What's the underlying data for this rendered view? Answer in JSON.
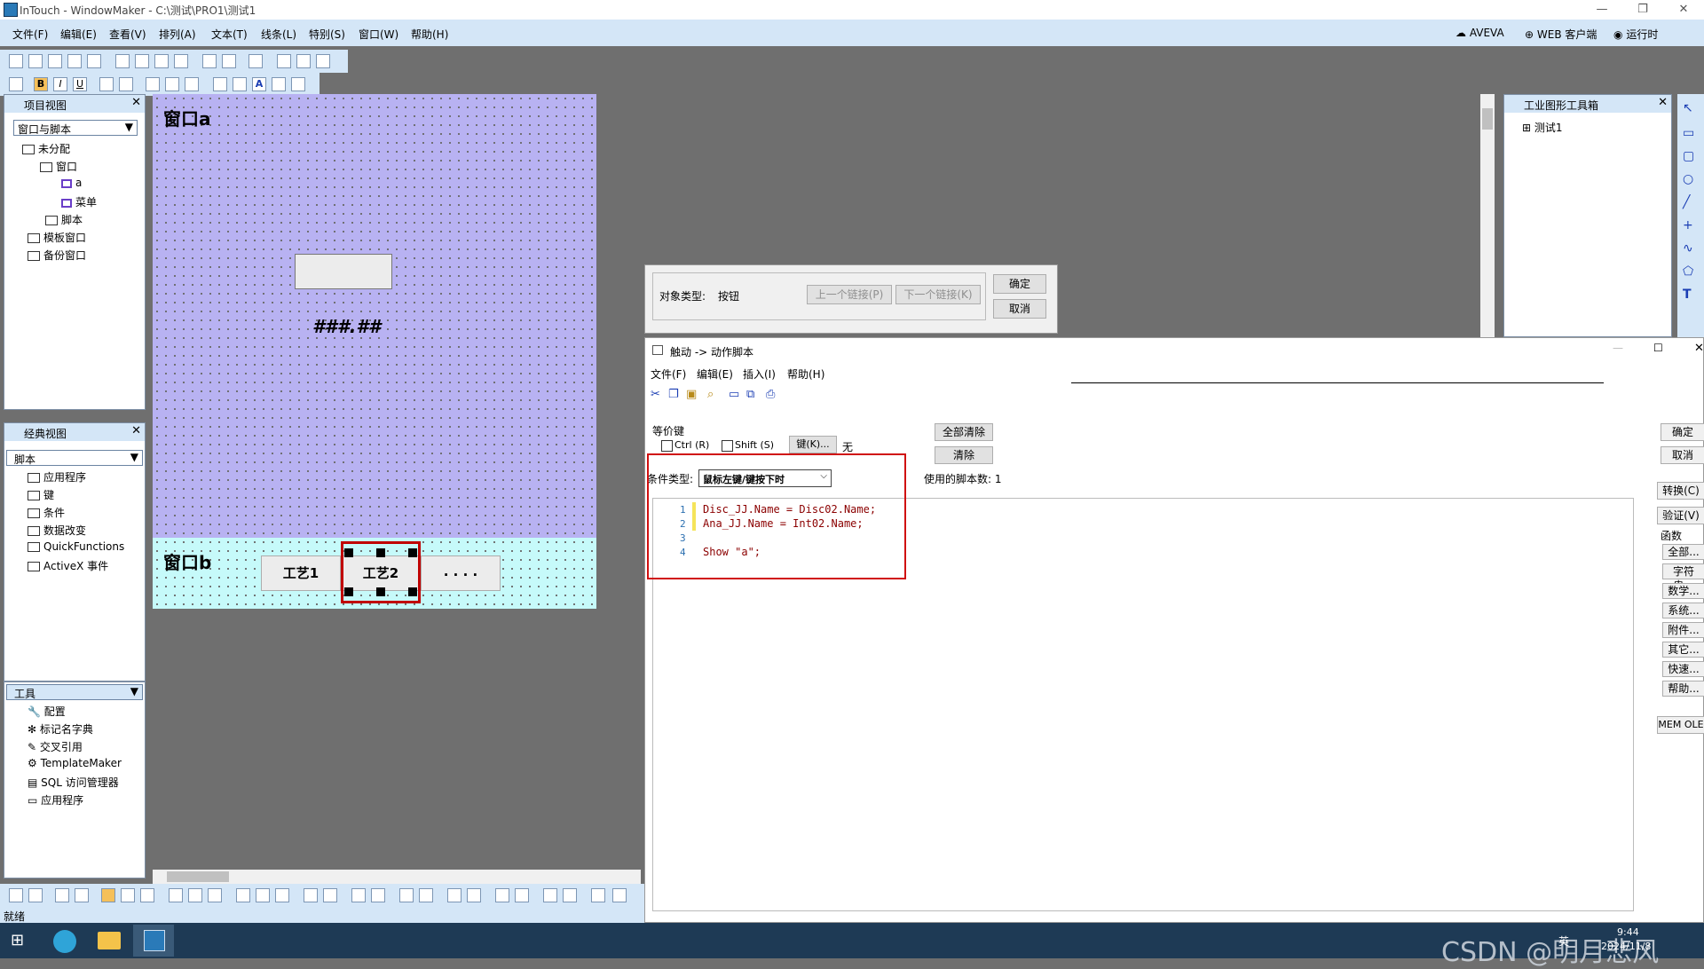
{
  "window": {
    "title": "InTouch - WindowMaker - C:\\测试\\PRO1\\测试1",
    "controls": [
      "—",
      "❐",
      "✕"
    ]
  },
  "menu": {
    "items": [
      "文件(F)",
      "编辑(E)",
      "查看(V)",
      "排列(A)",
      "文本(T)",
      "线条(L)",
      "特别(S)",
      "窗口(W)",
      "帮助(H)"
    ],
    "right_items": [
      "AVEVA",
      "WEB 客户端",
      "运行时"
    ]
  },
  "project_view": {
    "title": "项目视图",
    "dropdown": "窗口与脚本",
    "tree": [
      "未分配",
      "窗口",
      "a",
      "菜单",
      "脚本",
      "模板窗口",
      "备份窗口"
    ]
  },
  "classic_view": {
    "title": "经典视图",
    "dropdown": "脚本",
    "tree": [
      "应用程序",
      "键",
      "条件",
      "数据改变",
      "QuickFunctions",
      "ActiveX 事件"
    ]
  },
  "tools": {
    "dropdown": "工具",
    "tree": [
      "配置",
      "标记名字典",
      "交叉引用",
      "TemplateMaker",
      "SQL 访问管理器",
      "应用程序"
    ]
  },
  "canvas": {
    "window_a_label": "窗口a",
    "value_text": "###.##",
    "window_b_label": "窗口b",
    "buttons": [
      "工艺1",
      "工艺2",
      ". . . ."
    ]
  },
  "toolbox": {
    "title": "工业图形工具箱",
    "tree_item": "测试1"
  },
  "link_dialog": {
    "object_type_label": "对象类型:",
    "object_type_value": "按钮",
    "prev_link": "上一个链接(P)",
    "next_link": "下一个链接(K)",
    "ok": "确定",
    "cancel": "取消"
  },
  "script_editor": {
    "title": "触动 -> 动作脚本",
    "menu": [
      "文件(F)",
      "编辑(E)",
      "插入(I)",
      "帮助(H)"
    ],
    "equiv_key_label": "等价键",
    "ctrl": "Ctrl (R)",
    "shift": "Shift (S)",
    "key_button": "键(K)...",
    "key_value": "无",
    "clear_all": "全部清除",
    "clear": "清除",
    "condition_label": "条件类型:",
    "condition_value": "鼠标左键/键按下时",
    "script_count_label": "使用的脚本数: 1",
    "code_lines": [
      "Disc_JJ.Name = Disc02.Name;",
      "Ana_JJ.Name = Int02.Name;",
      "",
      "Show \"a\";"
    ],
    "line_numbers": [
      "1",
      "2",
      "3",
      "4"
    ],
    "right_buttons": [
      "确定",
      "取消",
      "转换(C)",
      "验证(V)"
    ],
    "functions_label": "函数",
    "function_buttons": [
      "全部...",
      "字符串...",
      "数学...",
      "系统...",
      "附件...",
      "其它...",
      "快速...",
      "帮助..."
    ],
    "mem_ole": "MEM OLE"
  },
  "status": {
    "text": "就绪"
  },
  "taskbar": {
    "time": "9:44",
    "date": "2024/11/8",
    "lang": "英",
    "watermark": "CSDN @明月悲风"
  }
}
